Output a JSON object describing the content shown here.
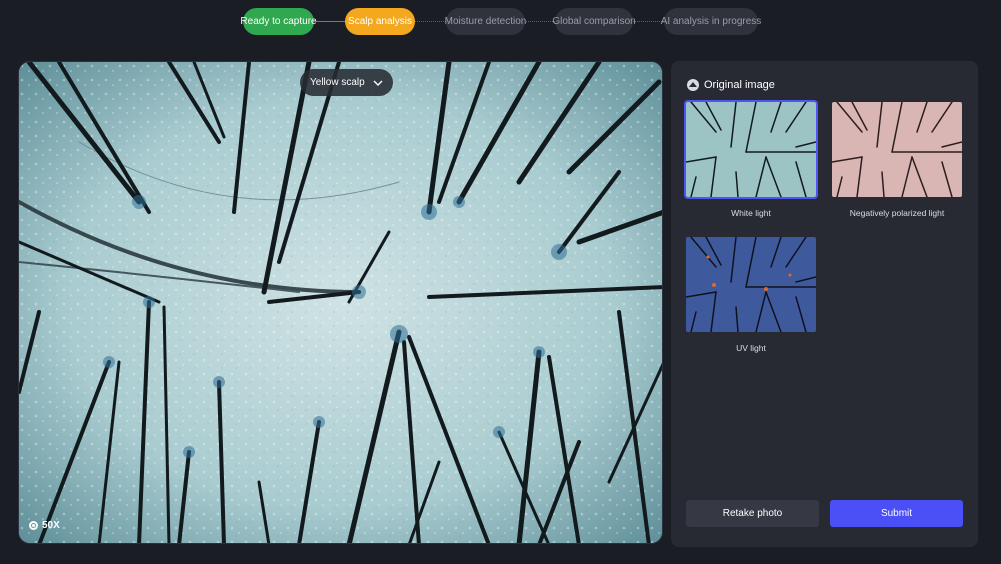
{
  "stepper": {
    "steps": [
      {
        "label": "Ready to capture",
        "state": "done"
      },
      {
        "label": "Scalp analysis",
        "state": "active"
      },
      {
        "label": "Moisture detection",
        "state": "pending"
      },
      {
        "label": "Global comparison",
        "state": "pending"
      },
      {
        "label": "AI analysis in progress",
        "state": "pending"
      }
    ]
  },
  "viewer": {
    "mode_select": "Yellow scalp",
    "zoom": "50X"
  },
  "panel": {
    "title": "Original image",
    "thumbnails": [
      {
        "label": "White light",
        "selected": true
      },
      {
        "label": "Negatively polarized light",
        "selected": false
      },
      {
        "label": "UV light",
        "selected": false
      }
    ],
    "retake_label": "Retake photo",
    "submit_label": "Submit"
  },
  "colors": {
    "background": "#1b1d24",
    "done": "#2fa84f",
    "active": "#f4a81d",
    "accent": "#4a4ff6"
  }
}
